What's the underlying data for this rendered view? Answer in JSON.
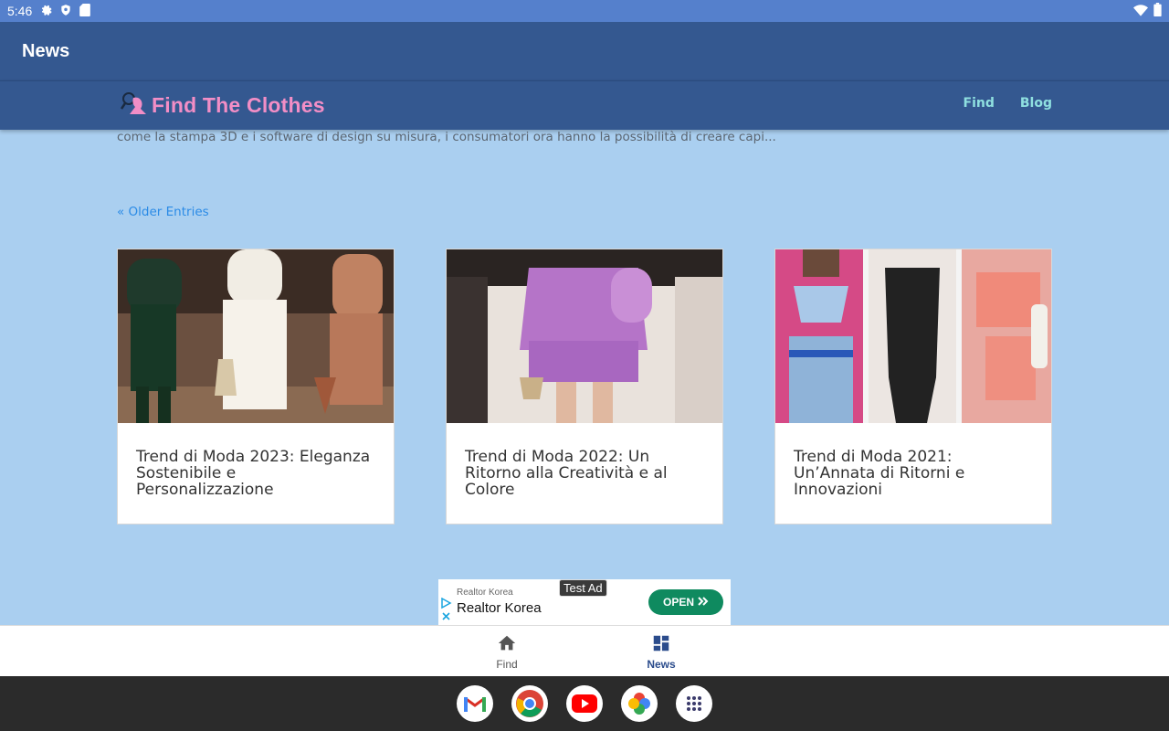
{
  "status": {
    "time": "5:46"
  },
  "appbar": {
    "title": "News"
  },
  "site": {
    "logo_text": "Find The Clothes",
    "nav": [
      {
        "label": "Find"
      },
      {
        "label": "Blog"
      }
    ]
  },
  "content": {
    "excerpt": "come la stampa 3D e i software di design su misura, i consumatori ora hanno la possibilità di creare capi...",
    "older_entries": "« Older Entries",
    "cards": [
      {
        "title": "Trend di Moda 2023: Eleganza Sostenibile e Personalizzazione"
      },
      {
        "title": "Trend di Moda 2022: Un Ritorno alla Creatività e al Colore"
      },
      {
        "title": "Trend di Moda 2021: Un’Annata di Ritorni e Innovazioni"
      }
    ]
  },
  "ad": {
    "tag": "Test Ad",
    "advertiser_small": "Realtor Korea",
    "advertiser": "Realtor Korea",
    "cta": "OPEN"
  },
  "bottomnav": {
    "items": [
      {
        "label": "Find",
        "icon": "home-icon",
        "active": false
      },
      {
        "label": "News",
        "icon": "dashboard-icon",
        "active": true
      }
    ]
  },
  "taskbar": {
    "apps": [
      "gmail-icon",
      "chrome-icon",
      "youtube-icon",
      "photos-icon",
      "app-drawer-icon"
    ]
  }
}
